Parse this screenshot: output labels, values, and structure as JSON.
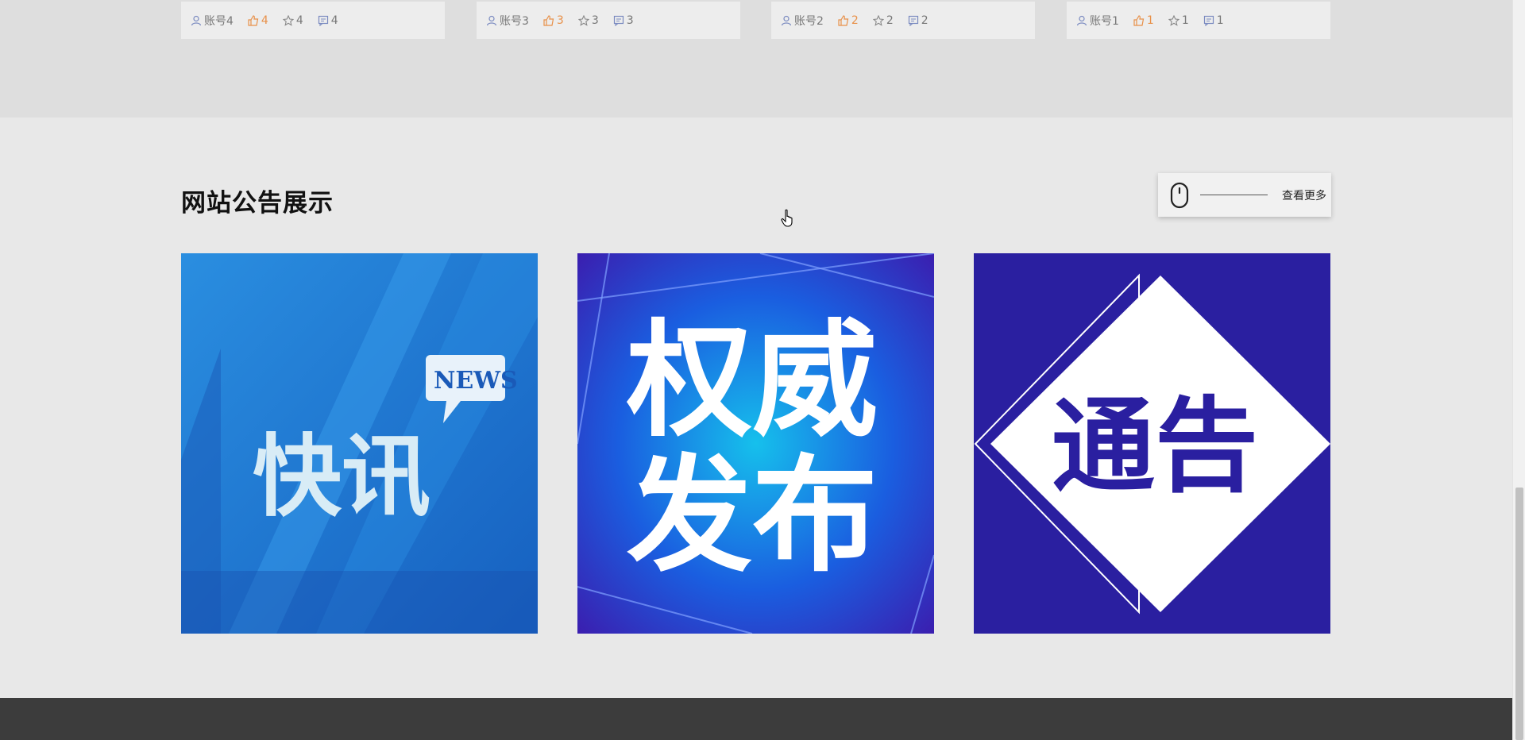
{
  "account_cards": [
    {
      "account": "账号4",
      "likes": "4",
      "favorites": "4",
      "comments": "4"
    },
    {
      "account": "账号3",
      "likes": "3",
      "favorites": "3",
      "comments": "3"
    },
    {
      "account": "账号2",
      "likes": "2",
      "favorites": "2",
      "comments": "2"
    },
    {
      "account": "账号1",
      "likes": "1",
      "favorites": "1",
      "comments": "1"
    }
  ],
  "notice_section": {
    "title": "网站公告展示",
    "more_label": "查看更多"
  },
  "notices": [
    {
      "image_text": "快讯",
      "image_badge": "NEWS",
      "bg_color": "#1a6fd0"
    },
    {
      "image_text_line1": "权威",
      "image_text_line2": "发布",
      "bg_color": "#1c5fe0"
    },
    {
      "image_text": "通告",
      "bg_color": "#2a1fa0"
    }
  ],
  "icons": {
    "user": "user-icon",
    "like": "thumbs-up-icon",
    "favorite": "star-icon",
    "comment": "comment-icon",
    "mouse": "mouse-icon"
  },
  "colors": {
    "like_accent": "#e8914a",
    "notice_blue": "#1a6fd0",
    "notice_indigo": "#2a1fa0",
    "footer": "#3c3c3c"
  }
}
